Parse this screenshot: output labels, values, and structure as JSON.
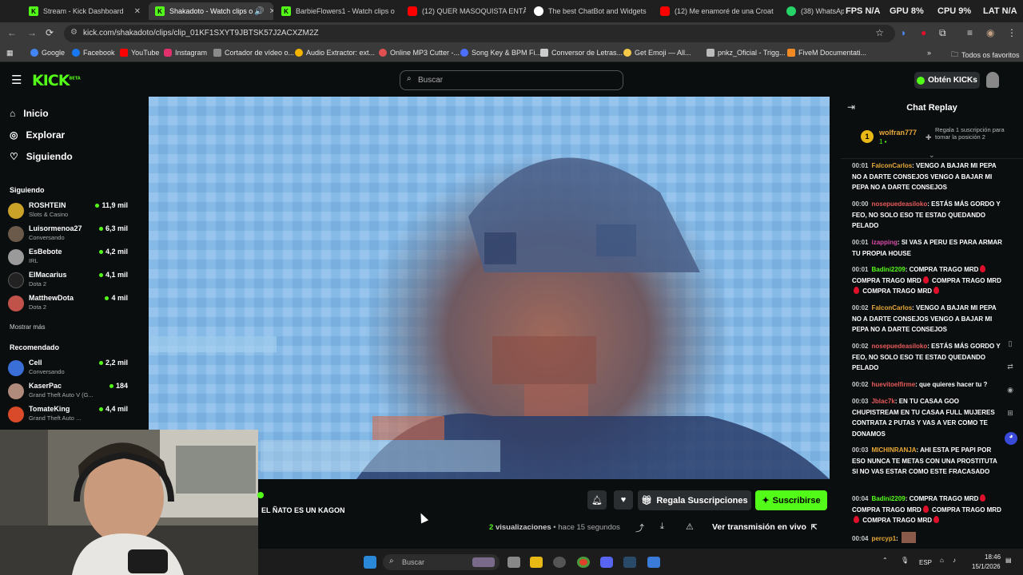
{
  "browser": {
    "tabs": [
      {
        "title": "Stream - Kick Dashboard",
        "fav": "K",
        "color": "#53fc18"
      },
      {
        "title": "Shakadoto - Watch clips o",
        "fav": "K",
        "color": "#53fc18"
      },
      {
        "title": "BarbieFlowers1 - Watch clips o",
        "fav": "K",
        "color": "#53fc18"
      },
      {
        "title": "(12) QUER MASOQUISTA ENTÃ",
        "fav": "",
        "color": "#ff0000"
      },
      {
        "title": "The best ChatBot and Widgets",
        "fav": "",
        "color": "#ffffff"
      },
      {
        "title": "(12) Me enamoré de una Croat",
        "fav": "",
        "color": "#ff0000"
      },
      {
        "title": "(38) WhatsApp",
        "fav": "",
        "color": "#25d366"
      }
    ],
    "stats": {
      "fps": "FPS N/A",
      "gpu": "GPU 8%",
      "cpu": "CPU 9%",
      "lat": "LAT N/A"
    },
    "url": "kick.com/shakadoto/clips/clip_01KF1SXYT9JBTSK57J2ACXZM2Z",
    "bookmarks": [
      {
        "label": "Google",
        "color": "#4285f4"
      },
      {
        "label": "Facebook",
        "color": "#1877f2"
      },
      {
        "label": "YouTube",
        "color": "#ff0000"
      },
      {
        "label": "Instagram",
        "color": "#e1306c"
      },
      {
        "label": "Cortador de vídeo o...",
        "color": "#8a8a8a"
      },
      {
        "label": "Audio Extractor: ext...",
        "color": "#f4b400"
      },
      {
        "label": "Online MP3 Cutter -...",
        "color": "#e05050"
      },
      {
        "label": "Song Key & BPM Fi...",
        "color": "#4c6fff"
      },
      {
        "label": "Conversor de Letras...",
        "color": "#cccccc"
      },
      {
        "label": "Get Emoji — All...",
        "color": "#f7c948"
      },
      {
        "label": "pnkz_Oficial - Trigg...",
        "color": "#bbbbbb"
      },
      {
        "label": "FiveM Documentati...",
        "color": "#f08a24"
      }
    ],
    "bookmarks_all": "Todos os favoritos"
  },
  "kick": {
    "search_placeholder": "Buscar",
    "kicks_button": "Obtén KICKs",
    "nav": [
      {
        "label": "Inicio",
        "icon": "home-icon"
      },
      {
        "label": "Explorar",
        "icon": "compass-icon"
      },
      {
        "label": "Siguiendo",
        "icon": "heart-icon"
      }
    ],
    "following_header": "Siguiendo",
    "following": [
      {
        "name": "ROSHTEIN",
        "category": "Slots & Casino",
        "viewers": "11,9 mil",
        "color": "#c9a227"
      },
      {
        "name": "Luisormenoa27",
        "category": "Conversando",
        "viewers": "6,3 mil",
        "color": "#6b5a4a"
      },
      {
        "name": "EsBebote",
        "category": "IRL",
        "viewers": "4,2 mil",
        "color": "#9a9a9a"
      },
      {
        "name": "ElMacarius",
        "category": "Dota 2",
        "viewers": "4,1 mil",
        "color": "#222222"
      },
      {
        "name": "MatthewDota",
        "category": "Dota 2",
        "viewers": "4 mil",
        "color": "#c0524a"
      }
    ],
    "show_more": "Mostrar más",
    "recommended_header": "Recomendado",
    "recommended": [
      {
        "name": "Cell",
        "category": "Conversando",
        "viewers": "2,2 mil",
        "color": "#3b6fd8"
      },
      {
        "name": "KaserPac",
        "category": "Grand Theft Auto V (G...",
        "viewers": "184",
        "color": "#b08a7a"
      },
      {
        "name": "TomateKing",
        "category": "Grand Theft Auto ...",
        "viewers": "4,4 mil",
        "color": "#d84a2a"
      }
    ],
    "clip_title": "EL ÑATO ES UN KAGON",
    "gift_button": "Regala Suscripciones",
    "subscribe_button": "Suscribirse",
    "views_count": "2",
    "views_text": "visualizaciones",
    "time_ago": "• hace 15 segundos",
    "live_link": "Ver transmisión en vivo",
    "chat": {
      "title": "Chat Replay",
      "pinned_user": "wolfran777",
      "pinned_rank": "1",
      "pinned_badge_count": "1",
      "pinned_text": "Regala 1 suscripción para tomar la posición 2",
      "messages": [
        {
          "time": "00:01",
          "user": "FalconCarlos",
          "color": "#e8a838",
          "text": "VENGO A BAJAR MI PEPA NO A DARTE CONSEJOS VENGO A BAJAR MI PEPA NO A DARTE CONSEJOS",
          "hearts": 0
        },
        {
          "time": "00:00",
          "user": "nosepuedeasiloko",
          "color": "#e85a5a",
          "text": "ESTÁS MÁS GORDO Y FEO, NO SOLO ESO TE ESTAD QUEDANDO PELADO",
          "hearts": 0
        },
        {
          "time": "00:01",
          "user": "izapping",
          "color": "#d84aa8",
          "text": "SI VAS A PERU ES PARA ARMAR TU PROPIA HOUSE",
          "hearts": 0
        },
        {
          "time": "00:01",
          "user": "Badini2209",
          "color": "#53fc18",
          "text": "COMPRA TRAGO MRD",
          "hearts": 4
        },
        {
          "time": "00:02",
          "user": "FalconCarlos",
          "color": "#e8a838",
          "text": "VENGO A BAJAR MI PEPA NO A DARTE CONSEJOS VENGO A BAJAR MI PEPA NO A DARTE CONSEJOS",
          "hearts": 0
        },
        {
          "time": "00:02",
          "user": "nosepuedeasiloko",
          "color": "#e85a5a",
          "text": "ESTÁS MÁS GORDO Y FEO, NO SOLO ESO TE ESTAD QUEDANDO PELADO",
          "hearts": 0
        },
        {
          "time": "00:02",
          "user": "huevitoelfirme",
          "color": "#e85a5a",
          "text": "que quieres hacer tu ?",
          "hearts": 0
        },
        {
          "time": "00:03",
          "user": "Jblac7k",
          "color": "#e85a5a",
          "text": "EN TU CASAA GOO CHUPISTREAM EN TU CASAA FULL MUJERES CONTRATA 2 PUTAS Y VAS A VER COMO TE DONAMOS",
          "hearts": 0
        },
        {
          "time": "00:03",
          "user": "MICHINRANJA",
          "color": "#e8a838",
          "text": "AHI ESTA PE PAPI POR ESO NUNCA TE METAS CON UNA PROSTITUTA SI NO VAS ESTAR COMO ESTE FRACASADO",
          "hearts": 0
        },
        {
          "time": "00:04",
          "user": "Badini2209",
          "color": "#53fc18",
          "text": "COMPRA TRAGO MRD",
          "hearts": 4
        },
        {
          "time": "00:04",
          "user": "percyp1",
          "color": "#e8a838",
          "text": "",
          "hearts": 0
        }
      ]
    }
  },
  "taskbar": {
    "search_placeholder": "Buscar",
    "lang": "ESP",
    "time": "18:46",
    "date": "15/1/2026"
  }
}
